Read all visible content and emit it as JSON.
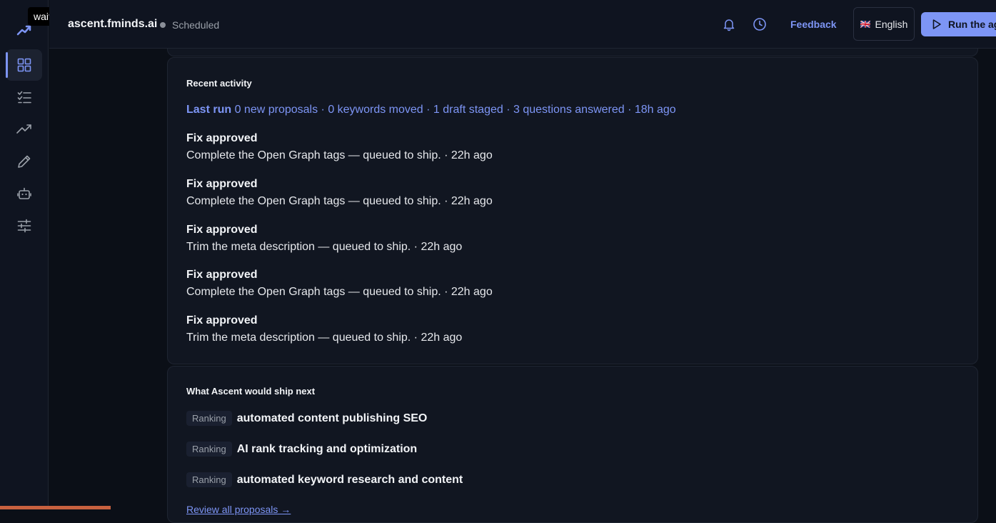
{
  "tooltip": "wait",
  "header": {
    "site_name": "ascent.fminds.ai",
    "status": "Scheduled",
    "feedback_label": "Feedback",
    "language_label": "English",
    "language_flag": "🇬🇧",
    "run_label": "Run the agent"
  },
  "sidebar": {
    "items": [
      {
        "icon": "dashboard-icon",
        "active": true
      },
      {
        "icon": "checklist-icon",
        "active": false
      },
      {
        "icon": "trending-icon",
        "active": false
      },
      {
        "icon": "pen-icon",
        "active": false
      },
      {
        "icon": "robot-icon",
        "active": false
      },
      {
        "icon": "sliders-icon",
        "active": false
      }
    ]
  },
  "recent": {
    "title": "Recent activity",
    "last_run_label": "Last run",
    "last_run_summary": "0 new proposals · 0 keywords moved · 1 draft staged · 3 questions answered · 18h ago",
    "items": [
      {
        "title": "Fix approved",
        "desc": "Complete the Open Graph tags — queued to ship. · 22h ago"
      },
      {
        "title": "Fix approved",
        "desc": "Complete the Open Graph tags — queued to ship. · 22h ago"
      },
      {
        "title": "Fix approved",
        "desc": "Trim the meta description — queued to ship. · 22h ago"
      },
      {
        "title": "Fix approved",
        "desc": "Complete the Open Graph tags — queued to ship. · 22h ago"
      },
      {
        "title": "Fix approved",
        "desc": "Trim the meta description — queued to ship. · 22h ago"
      }
    ]
  },
  "next": {
    "title": "What Ascent would ship next",
    "items": [
      {
        "tag": "Ranking",
        "title": "automated content publishing SEO"
      },
      {
        "tag": "Ranking",
        "title": "AI rank tracking and optimization"
      },
      {
        "tag": "Ranking",
        "title": "automated keyword research and content"
      }
    ],
    "review_link": "Review all proposals →"
  },
  "colors": {
    "accent": "#7d95f5",
    "background": "#0b0f17",
    "card": "#111621"
  }
}
